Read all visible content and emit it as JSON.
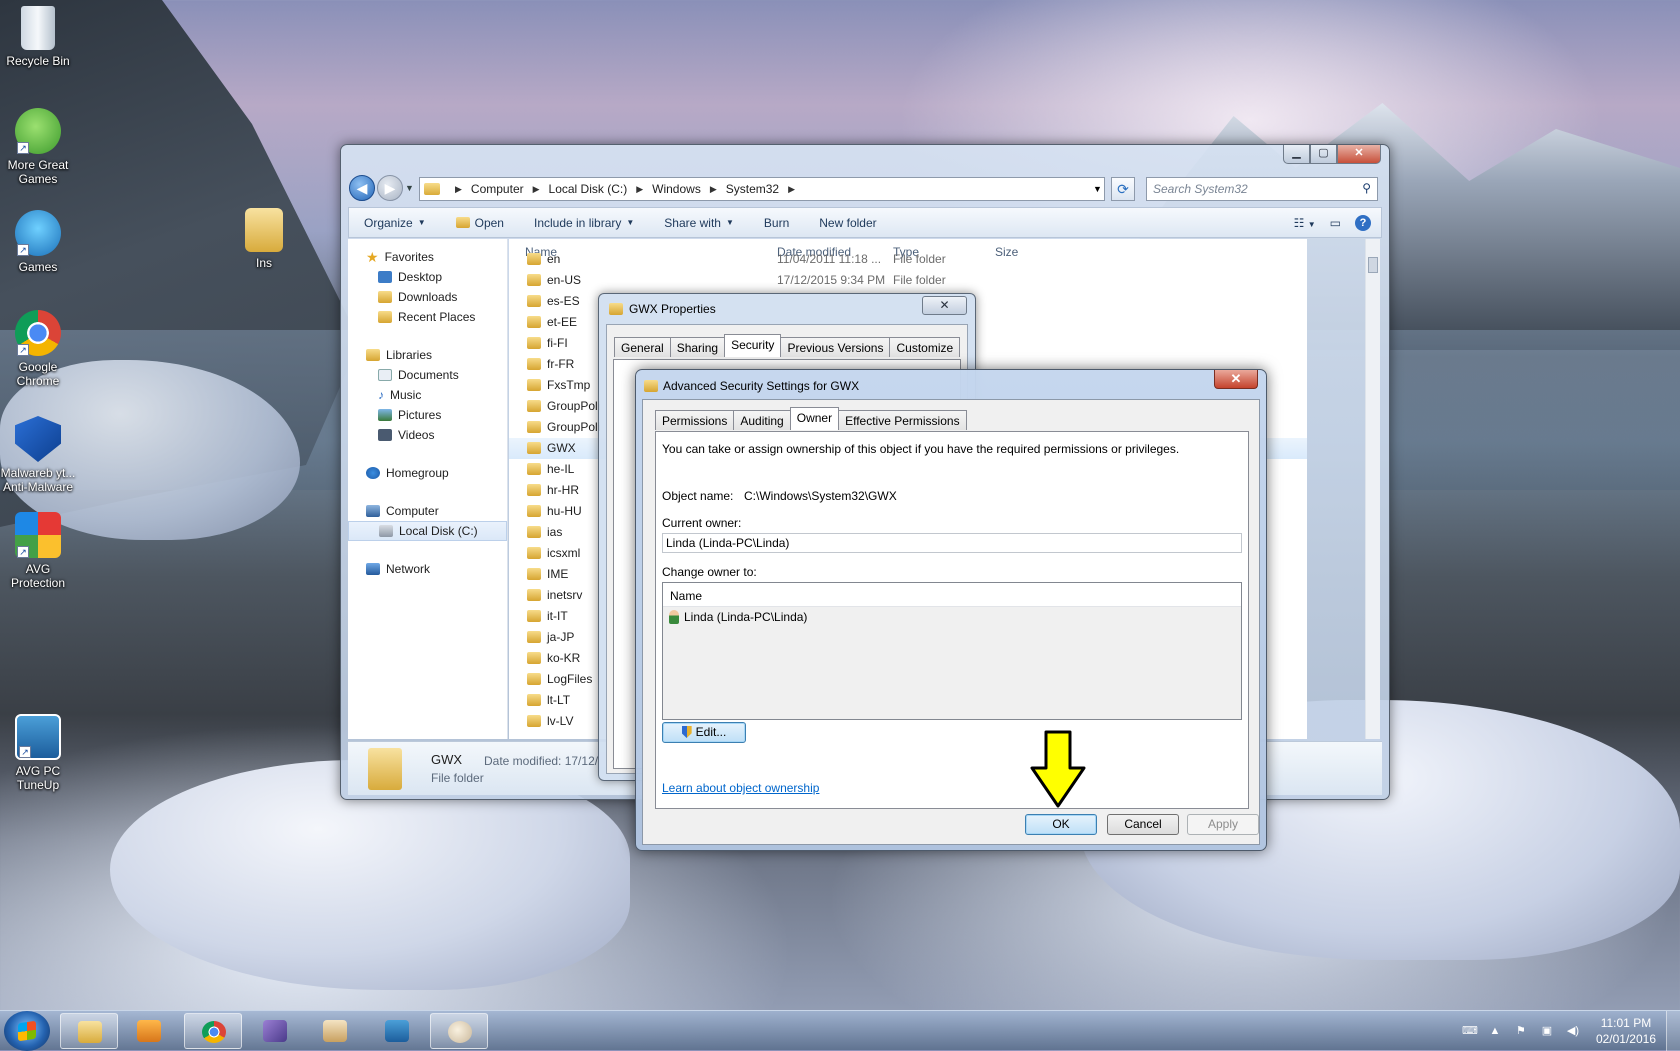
{
  "desktop": {
    "icons": [
      {
        "label": "Recycle Bin"
      },
      {
        "label": "More Great Games"
      },
      {
        "label": "Games"
      },
      {
        "label": "Google Chrome"
      },
      {
        "label": "Malwareb yt... Anti-Malware"
      },
      {
        "label": "AVG Protection"
      },
      {
        "label": "AVG PC TuneUp"
      },
      {
        "label": "Ins"
      }
    ]
  },
  "explorer": {
    "breadcrumb": [
      "Computer",
      "Local Disk (C:)",
      "Windows",
      "System32"
    ],
    "search_placeholder": "Search System32",
    "toolbar": {
      "organize": "Organize",
      "open": "Open",
      "include": "Include in library",
      "share": "Share with",
      "burn": "Burn",
      "new_folder": "New folder"
    },
    "nav": {
      "favorites": "Favorites",
      "desktop": "Desktop",
      "downloads": "Downloads",
      "recent": "Recent Places",
      "libraries": "Libraries",
      "documents": "Documents",
      "music": "Music",
      "pictures": "Pictures",
      "videos": "Videos",
      "homegroup": "Homegroup",
      "computer": "Computer",
      "local_disk": "Local Disk (C:)",
      "network": "Network"
    },
    "columns": {
      "name": "Name",
      "date": "Date modified",
      "type": "Type",
      "size": "Size"
    },
    "files": [
      {
        "name": "en",
        "date": "11/04/2011 11:18 ...",
        "type": "File folder"
      },
      {
        "name": "en-US",
        "date": "17/12/2015 9:34 PM",
        "type": "File folder"
      },
      {
        "name": "es-ES",
        "date": "",
        "type": ""
      },
      {
        "name": "et-EE",
        "date": "",
        "type": ""
      },
      {
        "name": "fi-FI",
        "date": "",
        "type": ""
      },
      {
        "name": "fr-FR",
        "date": "",
        "type": ""
      },
      {
        "name": "FxsTmp",
        "date": "",
        "type": ""
      },
      {
        "name": "GroupPoli",
        "date": "",
        "type": ""
      },
      {
        "name": "GroupPoli",
        "date": "",
        "type": ""
      },
      {
        "name": "GWX",
        "date": "",
        "type": ""
      },
      {
        "name": "he-IL",
        "date": "",
        "type": ""
      },
      {
        "name": "hr-HR",
        "date": "",
        "type": ""
      },
      {
        "name": "hu-HU",
        "date": "",
        "type": ""
      },
      {
        "name": "ias",
        "date": "",
        "type": ""
      },
      {
        "name": "icsxml",
        "date": "",
        "type": ""
      },
      {
        "name": "IME",
        "date": "",
        "type": ""
      },
      {
        "name": "inetsrv",
        "date": "",
        "type": ""
      },
      {
        "name": "it-IT",
        "date": "",
        "type": ""
      },
      {
        "name": "ja-JP",
        "date": "",
        "type": ""
      },
      {
        "name": "ko-KR",
        "date": "",
        "type": ""
      },
      {
        "name": "LogFiles",
        "date": "",
        "type": ""
      },
      {
        "name": "lt-LT",
        "date": "",
        "type": ""
      },
      {
        "name": "lv-LV",
        "date": "",
        "type": ""
      }
    ],
    "selected_index": 9,
    "details": {
      "name": "GWX",
      "type": "File folder",
      "date_label": "Date modified: 17/12/"
    }
  },
  "properties": {
    "title": "GWX Properties",
    "tabs": [
      "General",
      "Sharing",
      "Security",
      "Previous Versions",
      "Customize"
    ],
    "active_tab": "Security"
  },
  "advanced": {
    "title": "Advanced Security Settings for GWX",
    "tabs": [
      "Permissions",
      "Auditing",
      "Owner",
      "Effective Permissions"
    ],
    "active_tab": "Owner",
    "info": "You can take or assign ownership of this object if you have the required permissions or privileges.",
    "object_label": "Object name:",
    "object_value": "C:\\Windows\\System32\\GWX",
    "current_owner_label": "Current owner:",
    "current_owner_value": "Linda (Linda-PC\\Linda)",
    "change_owner_label": "Change owner to:",
    "list_header": "Name",
    "list_items": [
      "Linda (Linda-PC\\Linda)"
    ],
    "edit_label": "Edit...",
    "learn_link": "Learn about object ownership",
    "ok_label": "OK",
    "cancel_label": "Cancel",
    "apply_label": "Apply"
  },
  "taskbar": {
    "time": "11:01 PM",
    "date": "02/01/2016"
  },
  "colors": {
    "arrow": "#ffff00",
    "link": "#0066cc",
    "close_red": "#c5432d"
  }
}
